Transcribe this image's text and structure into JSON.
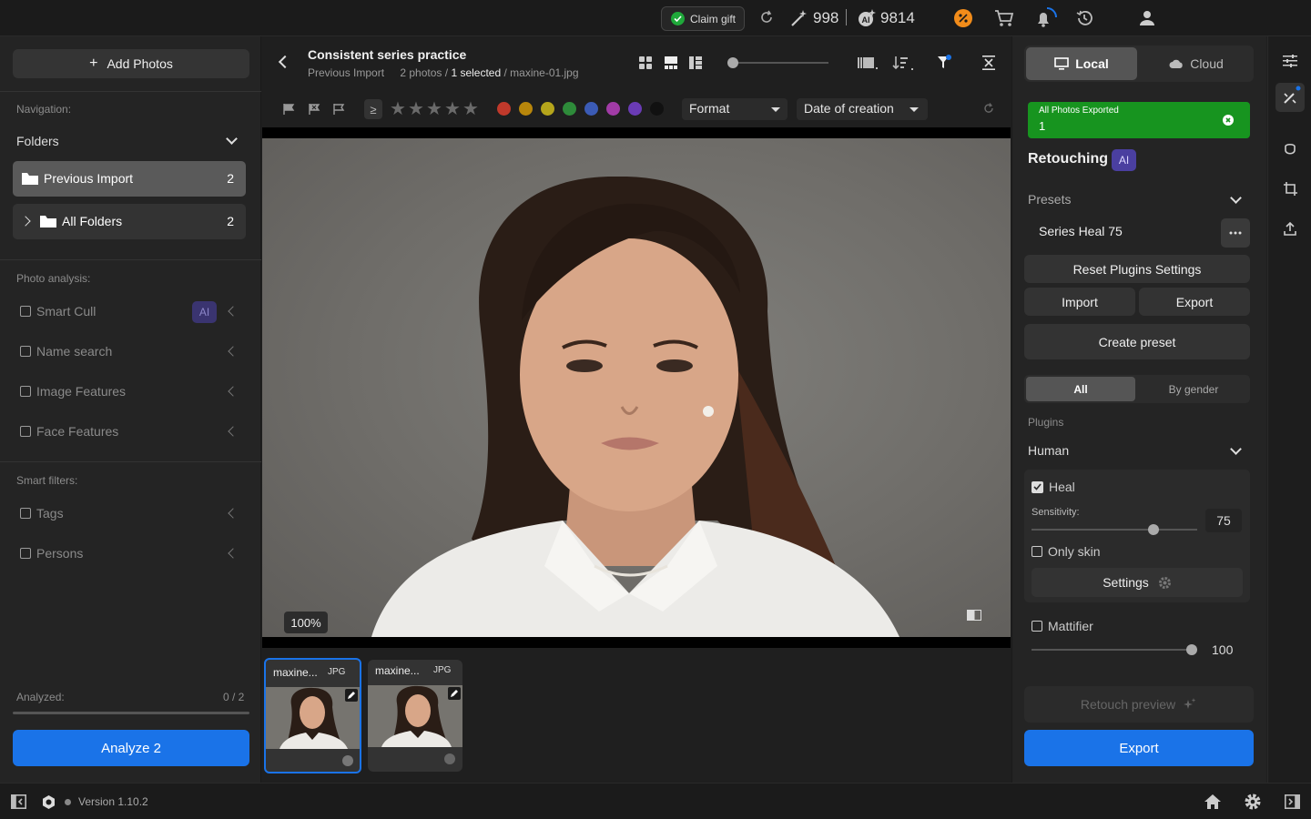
{
  "topbar": {
    "claim_gift": "Claim gift",
    "credits": "998",
    "ai_credits": "9814"
  },
  "left": {
    "add_photos": "Add Photos",
    "navigation_label": "Navigation:",
    "folders_label": "Folders",
    "folders": [
      {
        "name": "Previous Import",
        "count": "2"
      },
      {
        "name": "All Folders",
        "count": "2"
      }
    ],
    "photo_analysis_label": "Photo analysis:",
    "analysis_items": [
      "Smart Cull",
      "Name search",
      "Image Features",
      "Face Features"
    ],
    "ai_badge": "AI",
    "smart_filters_label": "Smart filters:",
    "filter_items": [
      "Tags",
      "Persons"
    ],
    "analyzed_label": "Analyzed:",
    "analyzed_value": "0 / 2",
    "analyzed_progress": 0,
    "analyze_button": "Analyze 2"
  },
  "center": {
    "title": "Consistent series practice",
    "subtitle_folder": "Previous Import",
    "subtitle_count": "2 photos /",
    "subtitle_selected": "1 selected",
    "subtitle_file": "/ maxine-01.jpg",
    "rating_op": "≥",
    "format_select": "Format",
    "date_select": "Date of creation",
    "zoom_label": "100%",
    "zoom_slider": 0,
    "thumbnails": [
      {
        "name": "maxine...",
        "ext": "JPG",
        "selected": true
      },
      {
        "name": "maxine...",
        "ext": "JPG",
        "selected": false
      }
    ],
    "color_labels": [
      "#c0392b",
      "#b8860b",
      "#b5a51b",
      "#2e8b3a",
      "#3b5bb5",
      "#a13ba6",
      "#6a3bb5",
      "#111111"
    ]
  },
  "right": {
    "local_tab": "Local",
    "cloud_tab": "Cloud",
    "export_banner_title": "All Photos Exported",
    "export_banner_value": "1",
    "retouching_title": "Retouching",
    "ai_badge": "AI",
    "presets_label": "Presets",
    "preset_name": "Series Heal 75",
    "reset_plugins": "Reset Plugins Settings",
    "import": "Import",
    "export_small": "Export",
    "create_preset": "Create preset",
    "seg_all": "All",
    "seg_gender": "By gender",
    "plugins_label": "Plugins",
    "human_label": "Human",
    "heal_label": "Heal",
    "sensitivity_label": "Sensitivity:",
    "sensitivity_value": "75",
    "only_skin": "Only skin",
    "settings": "Settings",
    "mattifier_label": "Mattifier",
    "mattifier_value": "100",
    "retouch_preview": "Retouch preview",
    "export_button": "Export"
  },
  "bottombar": {
    "version": "Version 1.10.2"
  },
  "colors": {
    "accent": "#1a73e8",
    "banner_green": "#17941f",
    "ai_purple": "#4a3fa0"
  }
}
